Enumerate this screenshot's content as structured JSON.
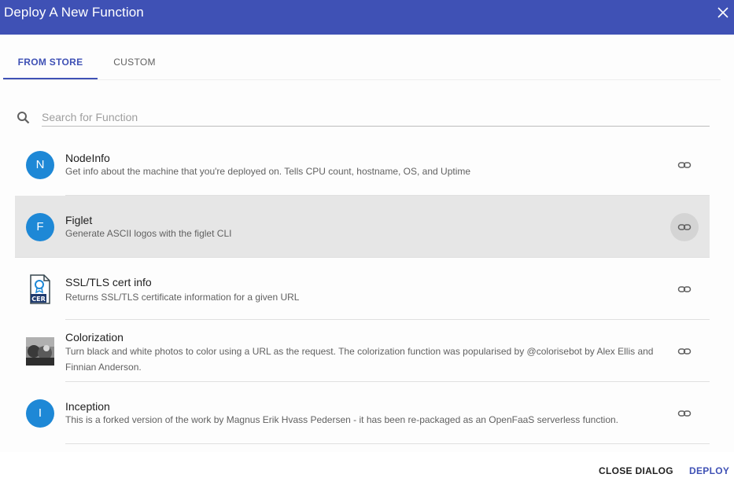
{
  "dialog": {
    "title": "Deploy A New Function"
  },
  "tabs": [
    {
      "label": "FROM STORE",
      "active": true
    },
    {
      "label": "CUSTOM",
      "active": false
    }
  ],
  "search": {
    "placeholder": "Search for Function",
    "value": ""
  },
  "functions": [
    {
      "avatar": "N",
      "name": "NodeInfo",
      "description": "Get info about the machine that you're deployed on. Tells CPU count, hostname, OS, and Uptime",
      "icon": "letter-avatar"
    },
    {
      "avatar": "F",
      "name": "Figlet",
      "description": "Generate ASCII logos with the figlet CLI",
      "icon": "letter-avatar",
      "selected": true
    },
    {
      "avatar": "",
      "name": "SSL/TLS cert info",
      "description": "Returns SSL/TLS certificate information for a given URL",
      "icon": "certificate-icon"
    },
    {
      "avatar": "",
      "name": "Colorization",
      "description": "Turn black and white photos to color using a URL as the request. The colorization function was popularised by @colorisebot by Alex Ellis and Finnian Anderson.",
      "icon": "photo-thumbnail"
    },
    {
      "avatar": "I",
      "name": "Inception",
      "description": "This is a forked version of the work by Magnus Erik Hvass Pedersen - it has been re-packaged as an OpenFaaS serverless function.",
      "icon": "letter-avatar"
    }
  ],
  "footer": {
    "close_label": "CLOSE DIALOG",
    "deploy_label": "DEPLOY"
  },
  "colors": {
    "primary": "#3f51b5",
    "avatar": "#1e88d6",
    "selected_row": "#e6e6e6"
  }
}
